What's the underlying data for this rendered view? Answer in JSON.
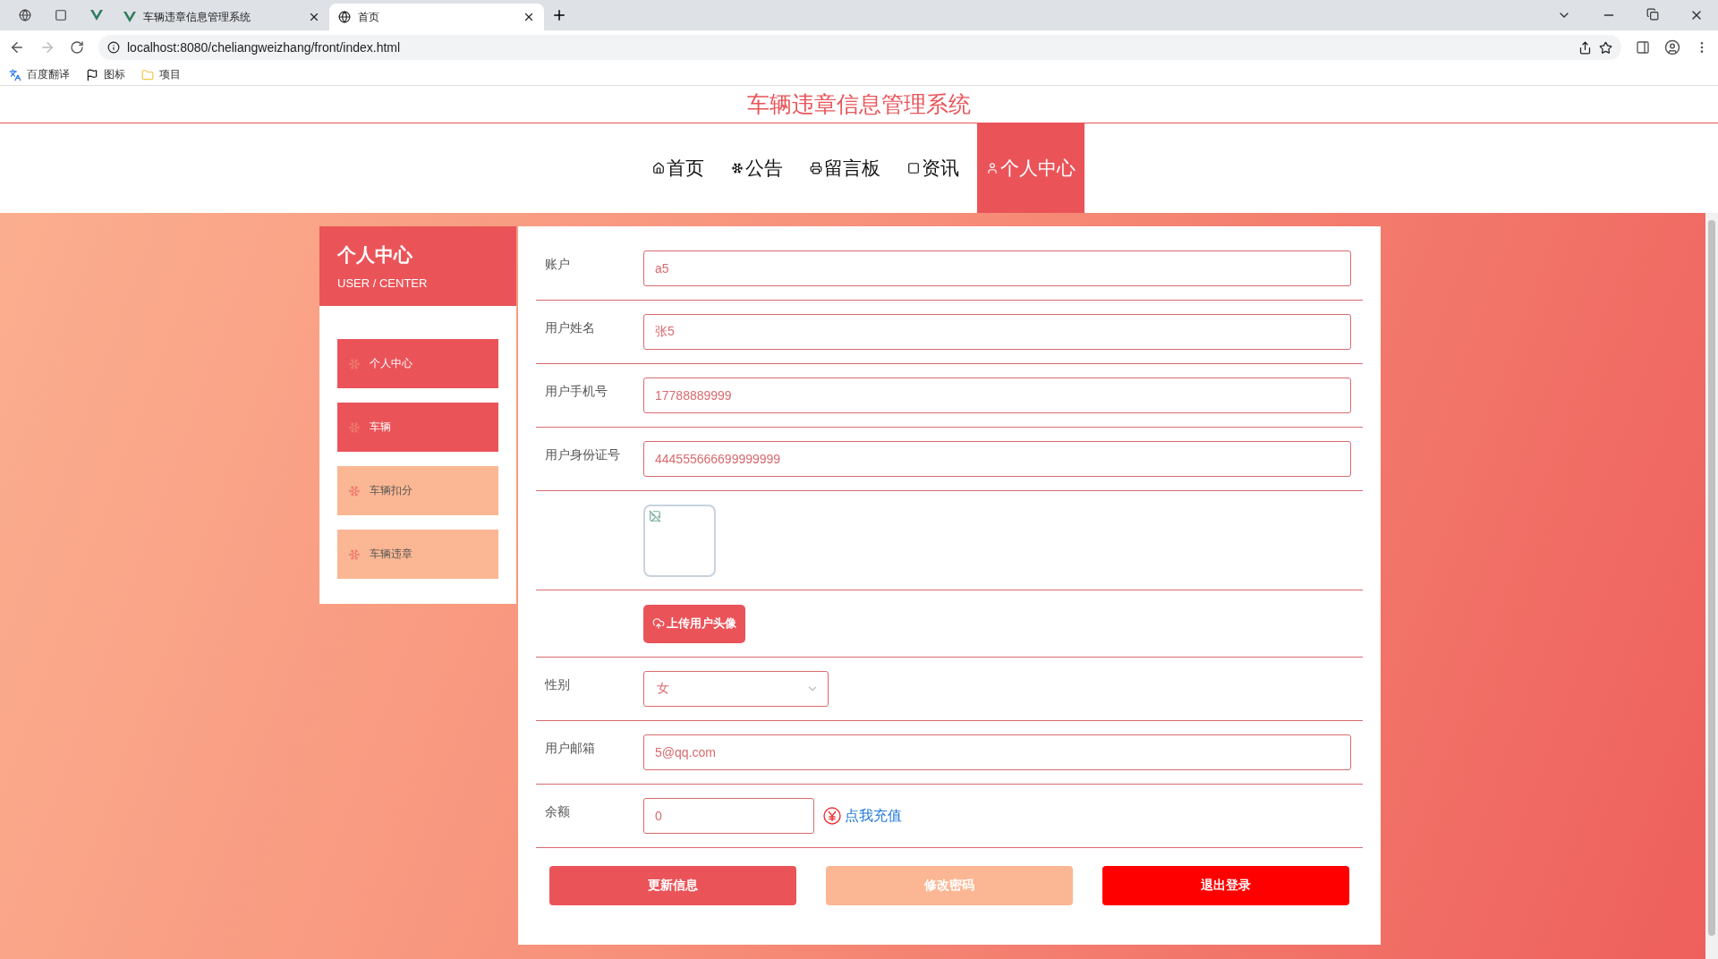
{
  "browser": {
    "tabs": [
      {
        "title": "车辆违章信息管理系统",
        "selected": false
      },
      {
        "title": "首页",
        "selected": true
      }
    ],
    "address": "localhost:8080/cheliangweizhang/front/index.html",
    "bookmarks": [
      "百度翻译",
      "图标",
      "项目"
    ]
  },
  "site_title": "车辆违章信息管理系统",
  "nav": [
    {
      "label": "首页",
      "selected": false
    },
    {
      "label": "公告",
      "selected": false
    },
    {
      "label": "留言板",
      "selected": false
    },
    {
      "label": "资讯",
      "selected": false
    },
    {
      "label": "个人中心",
      "selected": true
    }
  ],
  "sidebar": {
    "title": "个人中心",
    "subtitle": "USER / CENTER",
    "items": [
      {
        "label": "个人中心",
        "highlighted": true
      },
      {
        "label": "车辆",
        "highlighted": true
      },
      {
        "label": "车辆扣分",
        "highlighted": false
      },
      {
        "label": "车辆违章",
        "highlighted": false
      }
    ]
  },
  "form": [
    {
      "kind": "text",
      "label": "账户",
      "value": "a5"
    },
    {
      "kind": "text",
      "label": "用户姓名",
      "value": "张5"
    },
    {
      "kind": "text",
      "label": "用户手机号",
      "value": "17788889999"
    },
    {
      "kind": "text",
      "label": "用户身份证号",
      "value": "444555666699999999"
    },
    {
      "kind": "image"
    },
    {
      "kind": "upload",
      "button": "上传用户头像"
    },
    {
      "kind": "select",
      "label": "性别",
      "value": "女"
    },
    {
      "kind": "text",
      "label": "用户邮箱",
      "value": "5@qq.com"
    },
    {
      "kind": "balance",
      "label": "余额",
      "value": "0",
      "link": "点我充值"
    }
  ],
  "buttons": [
    {
      "label": "更新信息",
      "kind": "primary"
    },
    {
      "label": "修改密码",
      "kind": "secondary"
    },
    {
      "label": "退出登录",
      "kind": "danger"
    }
  ]
}
